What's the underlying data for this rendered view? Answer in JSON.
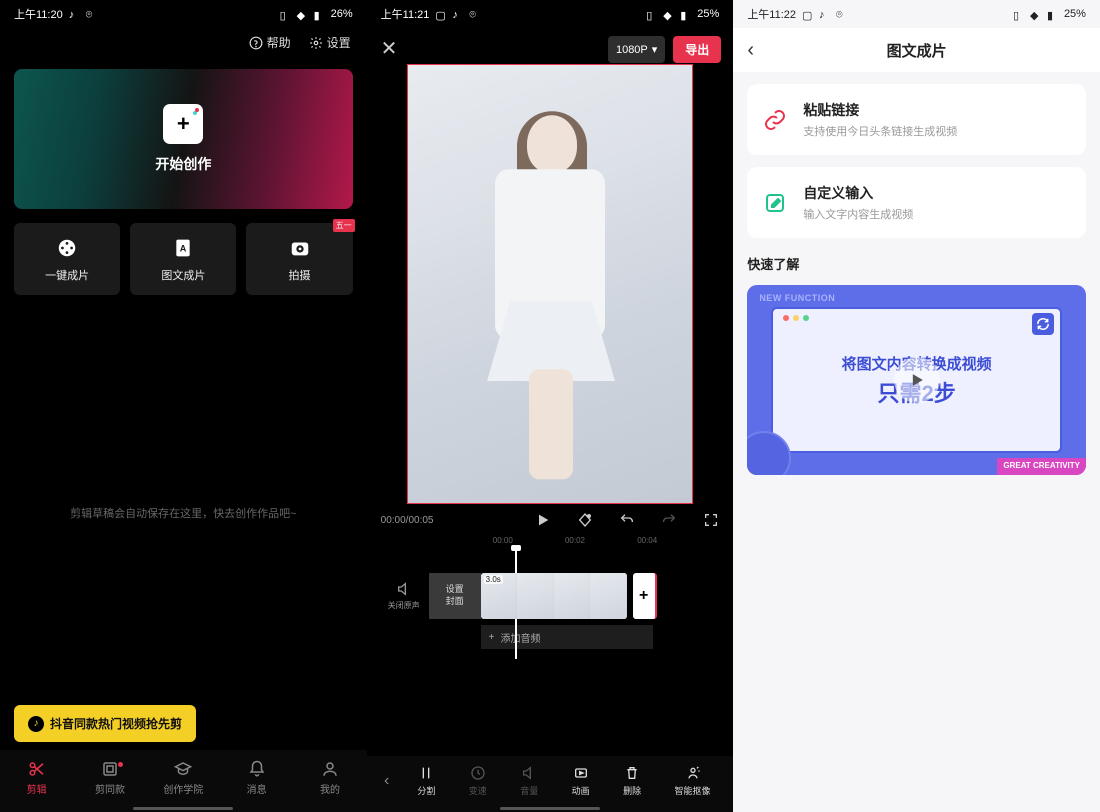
{
  "colors": {
    "accent": "#e8334e",
    "promo": "#f4cf26"
  },
  "phone1": {
    "statusbar": {
      "time": "上午11:20",
      "battery": "26%"
    },
    "header": {
      "help": "帮助",
      "settings": "设置"
    },
    "hero": {
      "cta": "开始创作"
    },
    "quick": [
      {
        "label": "一键成片",
        "name": "quick-one-click"
      },
      {
        "label": "图文成片",
        "name": "quick-text-to-video"
      },
      {
        "label": "拍摄",
        "name": "quick-shoot",
        "badge": "五一"
      }
    ],
    "empty_hint": "剪辑草稿会自动保存在这里，快去创作作品吧~",
    "promo": "抖音同款热门视频抢先剪",
    "nav": [
      {
        "label": "剪辑",
        "name": "nav-edit"
      },
      {
        "label": "剪同款",
        "name": "nav-templates"
      },
      {
        "label": "创作学院",
        "name": "nav-academy"
      },
      {
        "label": "消息",
        "name": "nav-messages"
      },
      {
        "label": "我的",
        "name": "nav-me"
      }
    ]
  },
  "phone2": {
    "statusbar": {
      "time": "上午11:21",
      "battery": "25%"
    },
    "resolution": "1080P",
    "export": "导出",
    "time_current": "00:00/00:05",
    "ruler": [
      "00:00",
      "00:02",
      "00:04"
    ],
    "sound_off": "关闭原声",
    "cover_setting": "设置\n封面",
    "clip_duration": "3.0s",
    "add_audio": "添加音频",
    "tools": [
      {
        "label": "分割",
        "name": "tool-split"
      },
      {
        "label": "变速",
        "name": "tool-speed",
        "dim": true
      },
      {
        "label": "音量",
        "name": "tool-volume",
        "dim": true
      },
      {
        "label": "动画",
        "name": "tool-animation"
      },
      {
        "label": "删除",
        "name": "tool-delete"
      },
      {
        "label": "智能抠像",
        "name": "tool-cutout"
      }
    ]
  },
  "phone3": {
    "statusbar": {
      "time": "上午11:22",
      "battery": "25%"
    },
    "title": "图文成片",
    "cards": [
      {
        "title": "粘贴链接",
        "sub": "支持使用今日头条链接生成视频",
        "name": "card-paste-link"
      },
      {
        "title": "自定义输入",
        "sub": "输入文字内容生成视频",
        "name": "card-custom-input"
      }
    ],
    "section": "快速了解",
    "video": {
      "new": "NEW FUNCTION",
      "line1": "将图文内容转换成视频",
      "line2": "只需2步",
      "great": "GREAT CREATIVITY"
    }
  }
}
